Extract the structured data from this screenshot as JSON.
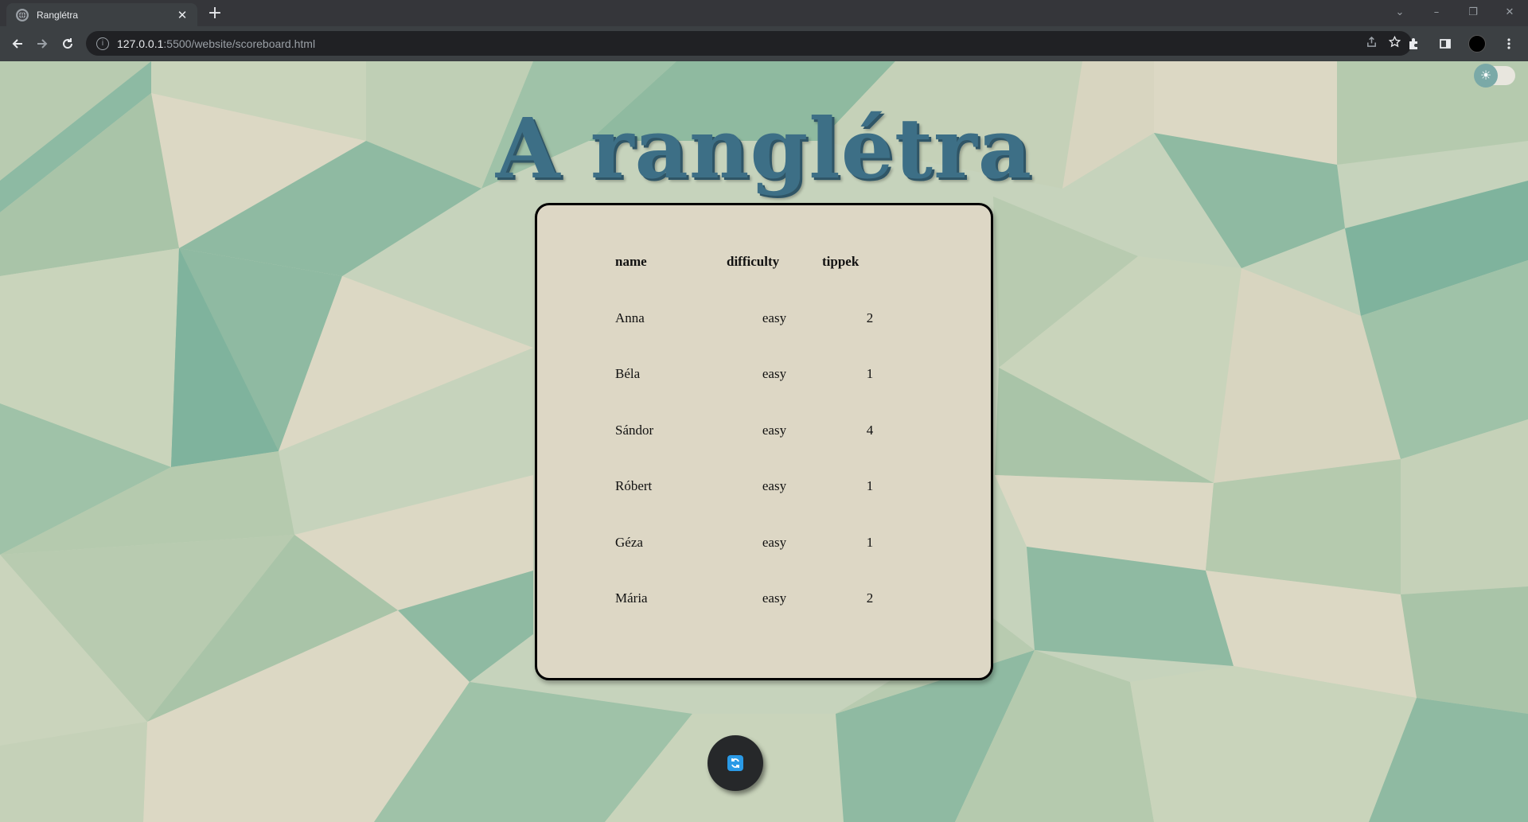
{
  "browser": {
    "tab_title": "Ranglétra",
    "tab_close": "✕",
    "new_tab": "+",
    "url_host": "127.0.0.1",
    "url_rest": ":5500/website/scoreboard.html",
    "window_controls": [
      "⌄",
      "–",
      "❐",
      "✕"
    ]
  },
  "page": {
    "title": "A ranglétra",
    "theme_toggle_icon": "☀",
    "table": {
      "headers": [
        "name",
        "difficulty",
        "tippek"
      ],
      "rows": [
        [
          "Anna",
          "easy",
          "2"
        ],
        [
          "Béla",
          "easy",
          "1"
        ],
        [
          "Sándor",
          "easy",
          "4"
        ],
        [
          "Róbert",
          "easy",
          "1"
        ],
        [
          "Géza",
          "easy",
          "1"
        ],
        [
          "Mária",
          "easy",
          "2"
        ]
      ]
    },
    "refresh_icon": "refresh-icon"
  },
  "colors": {
    "title": "#3d6f86",
    "board_bg": "#ddd7c5",
    "refresh_button": "#26282a",
    "refresh_icon": "#2a9ae6"
  }
}
